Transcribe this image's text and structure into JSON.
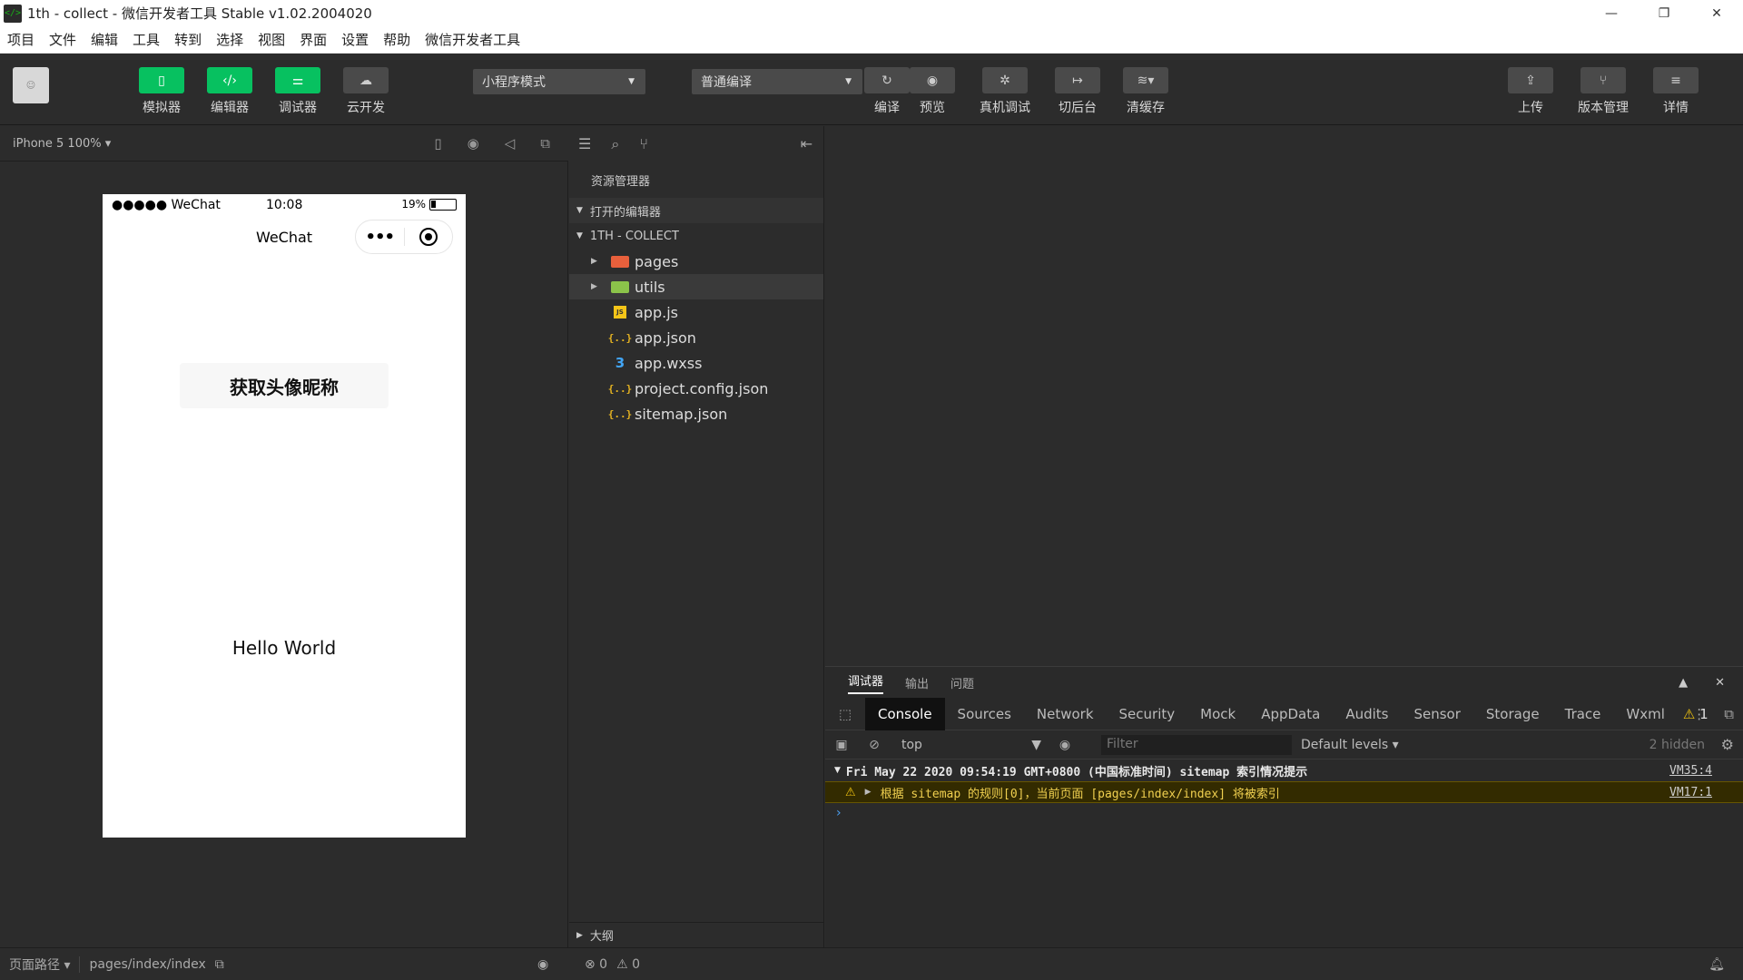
{
  "window": {
    "title": "1th - collect - 微信开发者工具 Stable v1.02.2004020",
    "icon": "</>",
    "minimize": "—",
    "maximize": "❐",
    "close": "✕"
  },
  "menu": [
    "项目",
    "文件",
    "编辑",
    "工具",
    "转到",
    "选择",
    "视图",
    "界面",
    "设置",
    "帮助",
    "微信开发者工具"
  ],
  "toolbar": {
    "simulator": "模拟器",
    "editor": "编辑器",
    "debugger": "调试器",
    "cloud": "云开发",
    "mode_select": "小程序模式",
    "compile_select": "普通编译",
    "compile": "编译",
    "preview": "预览",
    "real_debug": "真机调试",
    "background": "切后台",
    "clear_cache": "清缓存",
    "upload": "上传",
    "version": "版本管理",
    "details": "详情"
  },
  "simulator": {
    "device": "iPhone 5 100% ▾",
    "status_left": "●●●●● WeChat",
    "status_time": "10:08",
    "status_battery": "19%",
    "nav_title": "WeChat",
    "capsule_dots": "•••",
    "get_button": "获取头像昵称",
    "hello": "Hello World"
  },
  "explorer": {
    "title": "资源管理器",
    "open_editors": "打开的编辑器",
    "project": "1TH - COLLECT",
    "outline": "大纲",
    "files": [
      {
        "name": "pages",
        "type": "folder-red",
        "glyph": ""
      },
      {
        "name": "utils",
        "type": "folder-green",
        "glyph": ""
      },
      {
        "name": "app.js",
        "type": "js",
        "glyph": "JS"
      },
      {
        "name": "app.json",
        "type": "json",
        "glyph": "{..}"
      },
      {
        "name": "app.wxss",
        "type": "css",
        "glyph": "3"
      },
      {
        "name": "project.config.json",
        "type": "json",
        "glyph": "{..}"
      },
      {
        "name": "sitemap.json",
        "type": "json",
        "glyph": "{..}"
      }
    ]
  },
  "debug": {
    "tabs": [
      "调试器",
      "输出",
      "问题"
    ],
    "devtools_tabs": [
      "Console",
      "Sources",
      "Network",
      "Security",
      "Mock",
      "AppData",
      "Audits",
      "Sensor",
      "Storage",
      "Trace",
      "Wxml"
    ],
    "warn_count": "1",
    "context": "top",
    "filter_placeholder": "Filter",
    "levels": "Default levels ▾",
    "hidden": "2 hidden",
    "log_head": "Fri May 22 2020 09:54:19 GMT+0800 (中国标准时间) sitemap 索引情况提示",
    "log_head_src": "VM35:4",
    "log_warn": "根据 sitemap 的规则[0]，当前页面 [pages/index/index] 将被索引",
    "log_warn_src": "VM17:1",
    "prompt": "›"
  },
  "statusbar": {
    "path_label": "页面路径 ▾",
    "path": "pages/index/index",
    "errors": "⊗ 0",
    "warnings": "⚠ 0"
  },
  "colors": {
    "accent": "#07c160"
  }
}
